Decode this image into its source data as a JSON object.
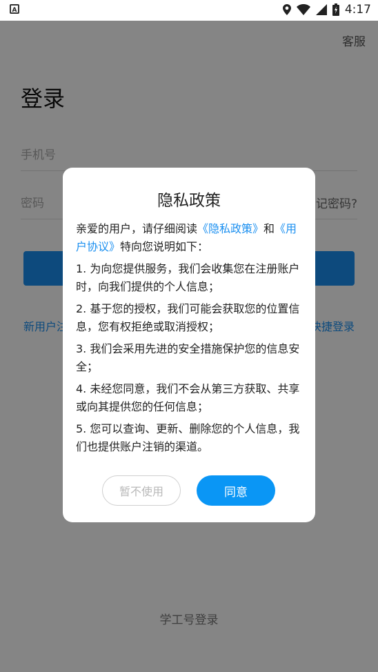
{
  "status_bar": {
    "time": "4:17",
    "app_icon": "a-icon",
    "icons": [
      "location-icon",
      "wifi-icon",
      "signal-icon",
      "battery-icon"
    ]
  },
  "login": {
    "service_label": "客服",
    "title": "登录",
    "phone_placeholder": "手机号",
    "password_placeholder": "密码",
    "forgot_visible": "记密码?",
    "register_visible": "新用户注",
    "quick_login_visible": "快捷登录",
    "student_login": "学工号登录",
    "button_color": "#1a8ff0"
  },
  "dialog": {
    "title": "隐私政策",
    "intro_prefix": "亲爱的用户，请仔细阅读",
    "privacy_link": "《隐私政策》",
    "intro_and": "和",
    "agreement_link": "《用户协议》",
    "intro_suffix": "特向您说明如下：",
    "items": [
      "1. 为向您提供服务，我们会收集您在注册账户时，向我们提供的个人信息；",
      "2. 基于您的授权，我们可能会获取您的位置信息，您有权拒绝或取消授权；",
      "3. 我们会采用先进的安全措施保护您的信息安全；",
      "4. 未经您同意，我们不会从第三方获取、共享或向其提供您的任何信息；",
      "5. 您可以查询、更新、删除您的个人信息，我们也提供账户注销的渠道。"
    ],
    "decline_label": "暂不使用",
    "agree_label": "同意",
    "accent_color": "#0a96f5"
  }
}
